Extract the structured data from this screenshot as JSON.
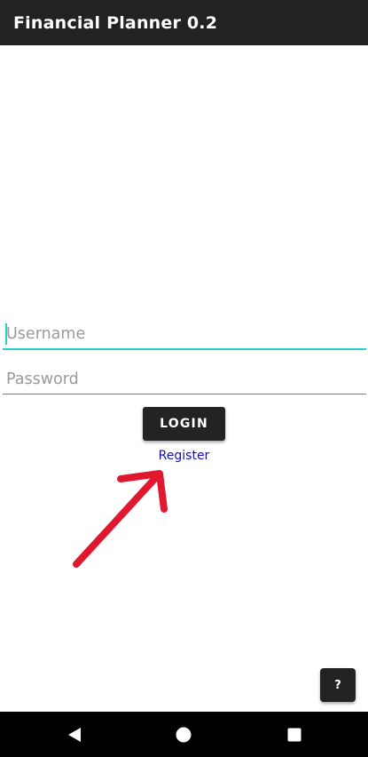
{
  "app_bar": {
    "title": "Financial Planner 0.2"
  },
  "login_form": {
    "username_placeholder": "Username",
    "password_placeholder": "Password",
    "login_label": "LOGIN",
    "register_label": "Register"
  },
  "help": {
    "label": "?"
  },
  "nav": {
    "back_icon": "back-triangle-icon",
    "home_icon": "home-circle-icon",
    "recents_icon": "recents-square-icon"
  },
  "colors": {
    "app_bar": "#222222",
    "accent": "#28cfc3",
    "link": "#1010b8",
    "annotation_arrow": "#e0182f"
  }
}
